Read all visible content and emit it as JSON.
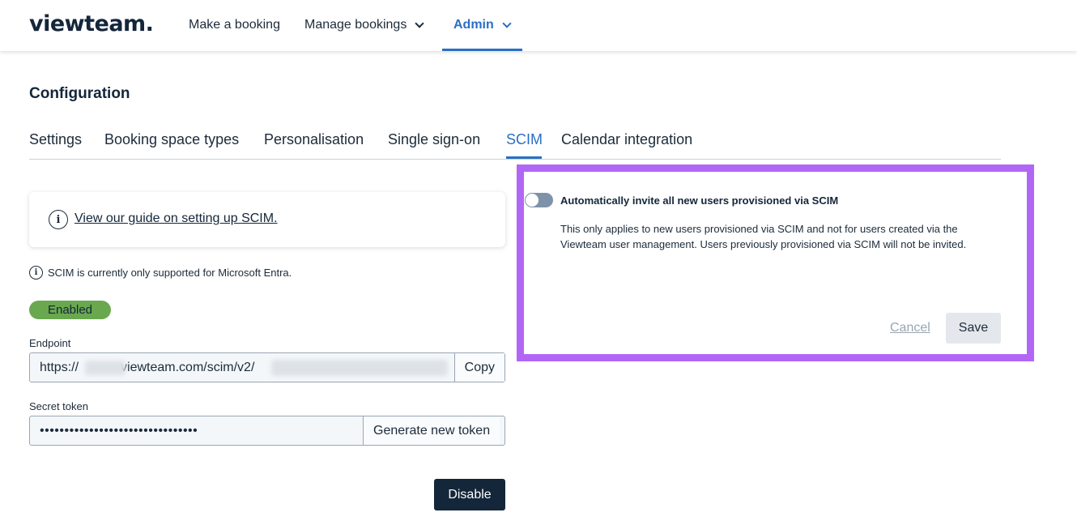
{
  "header": {
    "logo": "viewteam.",
    "nav": [
      {
        "label": "Make a booking"
      },
      {
        "label": "Manage bookings"
      },
      {
        "label": "Admin"
      }
    ]
  },
  "page": {
    "title": "Configuration"
  },
  "tabs": [
    {
      "label": "Settings"
    },
    {
      "label": "Booking space types"
    },
    {
      "label": "Personalisation"
    },
    {
      "label": "Single sign-on"
    },
    {
      "label": "SCIM",
      "active": true
    },
    {
      "label": "Calendar integration"
    }
  ],
  "scim": {
    "guide_link": "View our guide on setting up SCIM.",
    "support_note": "SCIM is currently only supported for Microsoft Entra.",
    "status_badge": "Enabled",
    "endpoint": {
      "label": "Endpoint",
      "value_prefix": "https://",
      "value_middle": "viewteam.com/scim/v2/",
      "copy_label": "Copy"
    },
    "secret": {
      "label": "Secret token",
      "value": "••••••••••••••••••••••••••••••••",
      "generate_label": "Generate new token"
    },
    "disable_label": "Disable"
  },
  "invite_panel": {
    "toggle_label": "Automatically invite all new users provisioned via SCIM",
    "toggle_on": false,
    "description": "This only applies to new users provisioned via SCIM and not for users created via the Viewteam user management. Users previously provisioned via SCIM will not be invited.",
    "cancel_label": "Cancel",
    "save_label": "Save"
  },
  "colors": {
    "accent": "#2a6fc4",
    "highlight_border": "#b266f5",
    "enabled_badge": "#6aa84f",
    "dark_button": "#14263a"
  }
}
